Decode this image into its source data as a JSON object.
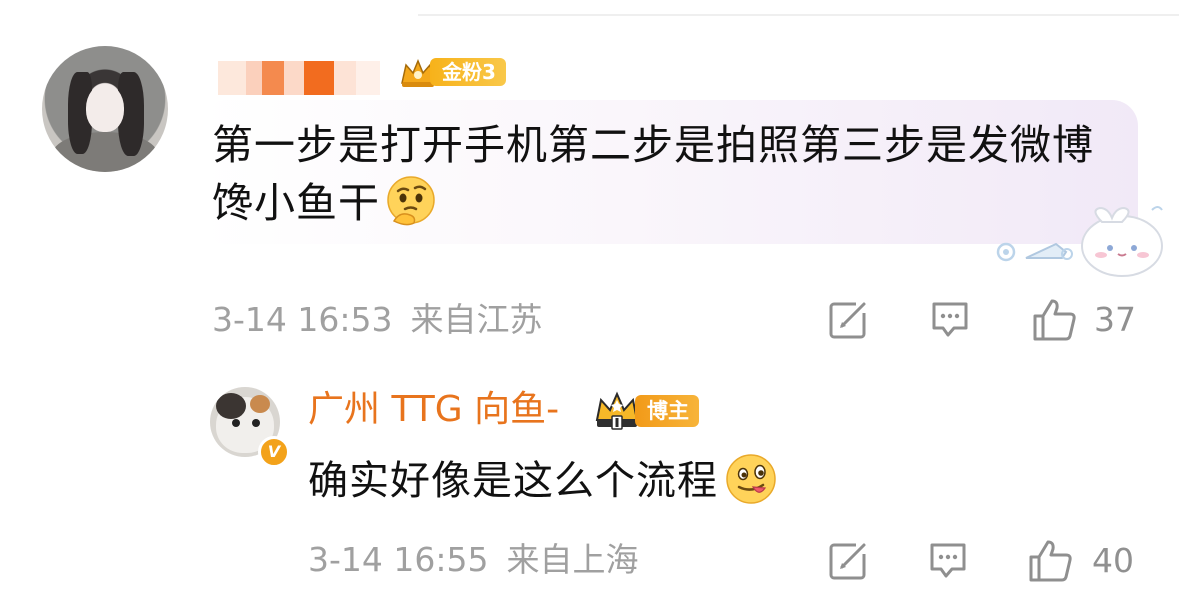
{
  "comment": {
    "badge_label": "金粉3",
    "text": "第一步是打开手机第二步是拍照第三步是发微博馋小鱼干",
    "emoji_icon": "thinking-face-icon",
    "time": "3-14 16:53",
    "location": "来自江苏",
    "like_count": "37"
  },
  "reply": {
    "username": "广州 TTG 向鱼-",
    "badge_label": "博主",
    "verified_mark": "V",
    "text": "确实好像是这么个流程",
    "emoji_icon": "tongue-out-face-icon",
    "time": "3-14 16:55",
    "location": "来自上海",
    "like_count": "40"
  },
  "colors": {
    "meta_gray": "#a0a0a0",
    "host_orange": "#e8741d",
    "badge_gold": "#f7b21a",
    "bubble_tint": "#f1e9f7"
  },
  "icons": {
    "share": "share-edit-icon",
    "comment": "comment-icon",
    "like": "thumbs-up-icon"
  }
}
